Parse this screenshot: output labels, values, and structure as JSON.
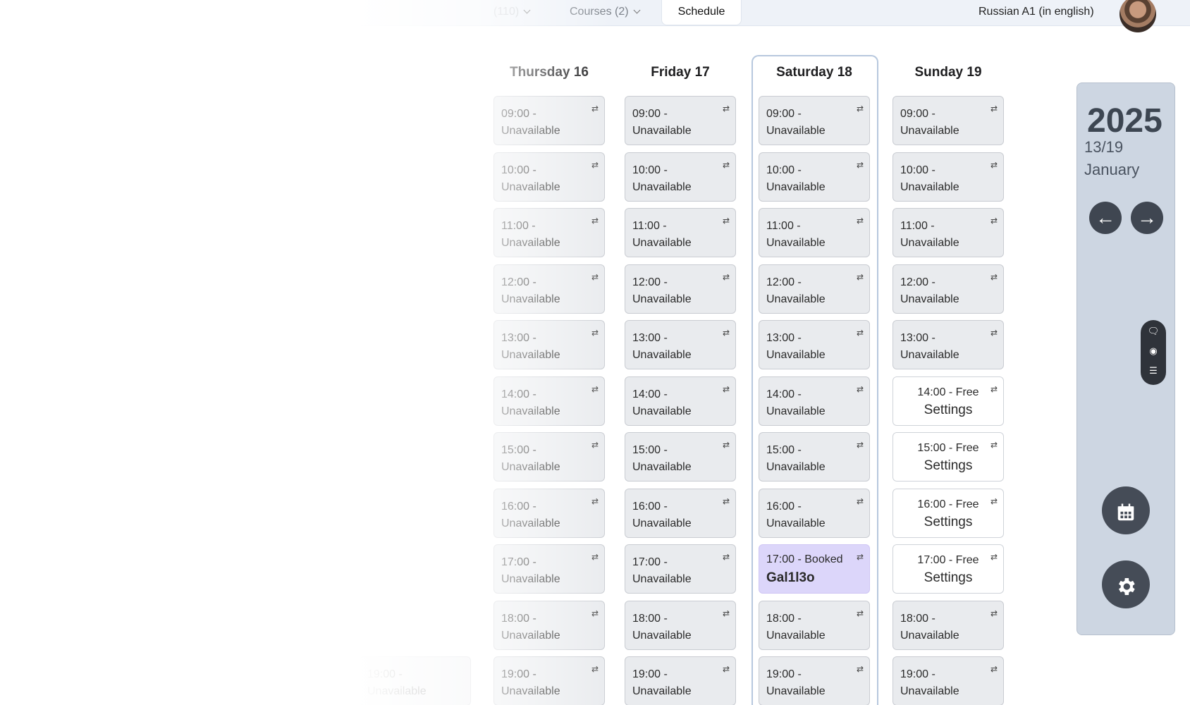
{
  "topbar": {
    "faded_label": "(110)",
    "courses_label": "Courses (2)",
    "schedule_label": "Schedule",
    "language_label": "Russian A1 (in english)"
  },
  "columns": [
    {
      "header": "Thursday 16",
      "slots": [
        {
          "time": "09:00 -",
          "status": "Unavailable"
        },
        {
          "time": "10:00 -",
          "status": "Unavailable"
        },
        {
          "time": "11:00 -",
          "status": "Unavailable"
        },
        {
          "time": "12:00 -",
          "status": "Unavailable"
        },
        {
          "time": "13:00 -",
          "status": "Unavailable"
        },
        {
          "time": "14:00 -",
          "status": "Unavailable"
        },
        {
          "time": "15:00 -",
          "status": "Unavailable"
        },
        {
          "time": "16:00 -",
          "status": "Unavailable"
        },
        {
          "time": "17:00 -",
          "status": "Unavailable"
        },
        {
          "time": "18:00 -",
          "status": "Unavailable"
        },
        {
          "time": "19:00 -",
          "status": "Unavailable"
        }
      ]
    },
    {
      "header": "Friday 17",
      "slots": [
        {
          "time": "09:00 -",
          "status": "Unavailable"
        },
        {
          "time": "10:00 -",
          "status": "Unavailable"
        },
        {
          "time": "11:00 -",
          "status": "Unavailable"
        },
        {
          "time": "12:00 -",
          "status": "Unavailable"
        },
        {
          "time": "13:00 -",
          "status": "Unavailable"
        },
        {
          "time": "14:00 -",
          "status": "Unavailable"
        },
        {
          "time": "15:00 -",
          "status": "Unavailable"
        },
        {
          "time": "16:00 -",
          "status": "Unavailable"
        },
        {
          "time": "17:00 -",
          "status": "Unavailable"
        },
        {
          "time": "18:00 -",
          "status": "Unavailable"
        },
        {
          "time": "19:00 -",
          "status": "Unavailable"
        }
      ]
    },
    {
      "header": "Saturday 18",
      "slots": [
        {
          "time": "09:00 -",
          "status": "Unavailable"
        },
        {
          "time": "10:00 -",
          "status": "Unavailable"
        },
        {
          "time": "11:00 -",
          "status": "Unavailable"
        },
        {
          "time": "12:00 -",
          "status": "Unavailable"
        },
        {
          "time": "13:00 -",
          "status": "Unavailable"
        },
        {
          "time": "14:00 -",
          "status": "Unavailable"
        },
        {
          "time": "15:00 -",
          "status": "Unavailable"
        },
        {
          "time": "16:00 -",
          "status": "Unavailable"
        },
        {
          "time": "17:00 - Booked",
          "status": "Gal1l3o",
          "kind": "booked"
        },
        {
          "time": "18:00 -",
          "status": "Unavailable"
        },
        {
          "time": "19:00 -",
          "status": "Unavailable"
        }
      ]
    },
    {
      "header": "Sunday 19",
      "slots": [
        {
          "time": "09:00 -",
          "status": "Unavailable"
        },
        {
          "time": "10:00 -",
          "status": "Unavailable"
        },
        {
          "time": "11:00 -",
          "status": "Unavailable"
        },
        {
          "time": "12:00 -",
          "status": "Unavailable"
        },
        {
          "time": "13:00 -",
          "status": "Unavailable"
        },
        {
          "time": "14:00 - Free",
          "status": "Settings",
          "kind": "free"
        },
        {
          "time": "15:00 - Free",
          "status": "Settings",
          "kind": "free"
        },
        {
          "time": "16:00 - Free",
          "status": "Settings",
          "kind": "free"
        },
        {
          "time": "17:00 - Free",
          "status": "Settings",
          "kind": "free"
        },
        {
          "time": "18:00 -",
          "status": "Unavailable"
        },
        {
          "time": "19:00 -",
          "status": "Unavailable"
        }
      ]
    }
  ],
  "left_faded_slots": [
    {
      "time": "19:00 -",
      "status": "Unavailable"
    }
  ],
  "panel": {
    "year": "2025",
    "range": "13/19",
    "month": "January",
    "prev_arrow": "←",
    "next_arrow": "→"
  },
  "icons": {
    "swap": "swap-arrows-icon",
    "chat": "chat-icon",
    "eye": "eye-icon",
    "list": "list-icon",
    "calendar": "calendar-icon",
    "gear": "gear-icon"
  }
}
